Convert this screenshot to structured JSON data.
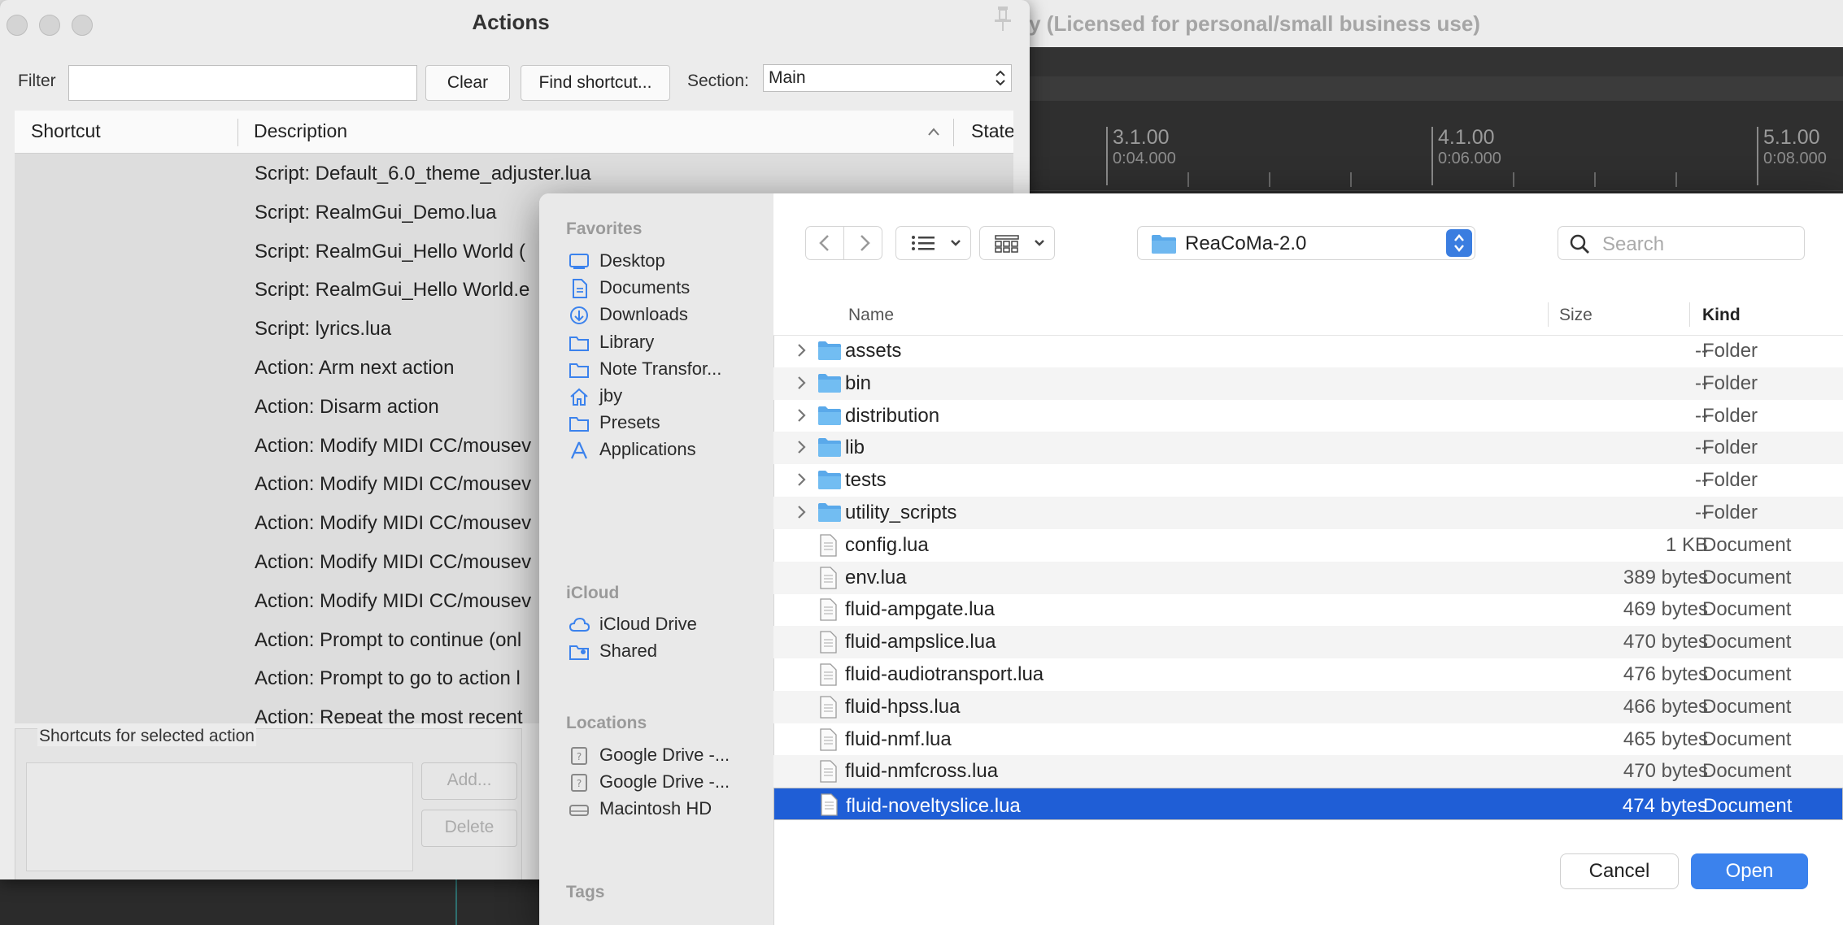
{
  "reaper": {
    "title_fragment": "ry (Licensed for personal/small business use)",
    "ruler": [
      {
        "measure": "3.1.00",
        "time": "0:04.000"
      },
      {
        "measure": "4.1.00",
        "time": "0:06.000"
      },
      {
        "measure": "5.1.00",
        "time": "0:08.000"
      }
    ]
  },
  "actions": {
    "title": "Actions",
    "filter_label": "Filter",
    "filter_value": "",
    "clear_label": "Clear",
    "find_shortcut_label": "Find shortcut...",
    "section_label": "Section:",
    "section_value": "Main",
    "columns": {
      "shortcut": "Shortcut",
      "description": "Description",
      "state": "State"
    },
    "rows": [
      "Script: Default_6.0_theme_adjuster.lua",
      "Script: RealmGui_Demo.lua",
      "Script: RealmGui_Hello World (",
      "Script: RealmGui_Hello World.e",
      "Script: lyrics.lua",
      "Action: Arm next action",
      "Action: Disarm action",
      "Action: Modify MIDI CC/mousev",
      "Action: Modify MIDI CC/mousev",
      "Action: Modify MIDI CC/mousev",
      "Action: Modify MIDI CC/mousev",
      "Action: Modify MIDI CC/mousev",
      "Action: Prompt to continue (onl",
      "Action: Prompt to go to action l",
      "Action: Repeat the most recent"
    ],
    "shortcuts_group_label": "Shortcuts for selected action",
    "add_label": "Add...",
    "delete_label": "Delete"
  },
  "dialog": {
    "sidebar": {
      "favorites_label": "Favorites",
      "favorites": [
        {
          "label": "Desktop",
          "icon": "desktop-icon"
        },
        {
          "label": "Documents",
          "icon": "document-icon"
        },
        {
          "label": "Downloads",
          "icon": "downloads-icon"
        },
        {
          "label": "Library",
          "icon": "folder-icon"
        },
        {
          "label": "Note Transfor...",
          "icon": "folder-icon"
        },
        {
          "label": "jby",
          "icon": "home-icon"
        },
        {
          "label": "Presets",
          "icon": "folder-icon"
        },
        {
          "label": "Applications",
          "icon": "applications-icon"
        }
      ],
      "icloud_label": "iCloud",
      "icloud": [
        {
          "label": "iCloud Drive",
          "icon": "cloud-icon"
        },
        {
          "label": "Shared",
          "icon": "shared-folder-icon"
        }
      ],
      "locations_label": "Locations",
      "locations": [
        {
          "label": "Google Drive -...",
          "icon": "drive-icon"
        },
        {
          "label": "Google Drive -...",
          "icon": "drive-icon"
        },
        {
          "label": "Macintosh HD",
          "icon": "disk-icon"
        }
      ],
      "tags_label": "Tags"
    },
    "path": "ReaCoMa-2.0",
    "search_placeholder": "Search",
    "columns": {
      "name": "Name",
      "size": "Size",
      "kind": "Kind"
    },
    "files": [
      {
        "name": "assets",
        "size": "--",
        "kind": "Folder",
        "type": "folder"
      },
      {
        "name": "bin",
        "size": "--",
        "kind": "Folder",
        "type": "folder"
      },
      {
        "name": "distribution",
        "size": "--",
        "kind": "Folder",
        "type": "folder"
      },
      {
        "name": "lib",
        "size": "--",
        "kind": "Folder",
        "type": "folder"
      },
      {
        "name": "tests",
        "size": "--",
        "kind": "Folder",
        "type": "folder"
      },
      {
        "name": "utility_scripts",
        "size": "--",
        "kind": "Folder",
        "type": "folder"
      },
      {
        "name": "config.lua",
        "size": "1 KB",
        "kind": "Document",
        "type": "doc"
      },
      {
        "name": "env.lua",
        "size": "389 bytes",
        "kind": "Document",
        "type": "doc"
      },
      {
        "name": "fluid-ampgate.lua",
        "size": "469 bytes",
        "kind": "Document",
        "type": "doc"
      },
      {
        "name": "fluid-ampslice.lua",
        "size": "470 bytes",
        "kind": "Document",
        "type": "doc"
      },
      {
        "name": "fluid-audiotransport.lua",
        "size": "476 bytes",
        "kind": "Document",
        "type": "doc"
      },
      {
        "name": "fluid-hpss.lua",
        "size": "466 bytes",
        "kind": "Document",
        "type": "doc"
      },
      {
        "name": "fluid-nmf.lua",
        "size": "465 bytes",
        "kind": "Document",
        "type": "doc"
      },
      {
        "name": "fluid-nmfcross.lua",
        "size": "470 bytes",
        "kind": "Document",
        "type": "doc"
      },
      {
        "name": "fluid-noveltyslice.lua",
        "size": "474 bytes",
        "kind": "Document",
        "type": "doc",
        "selected": true
      }
    ],
    "cancel_label": "Cancel",
    "open_label": "Open",
    "accent_color": "#3b82ed",
    "selection_color": "#1f5ed6"
  }
}
